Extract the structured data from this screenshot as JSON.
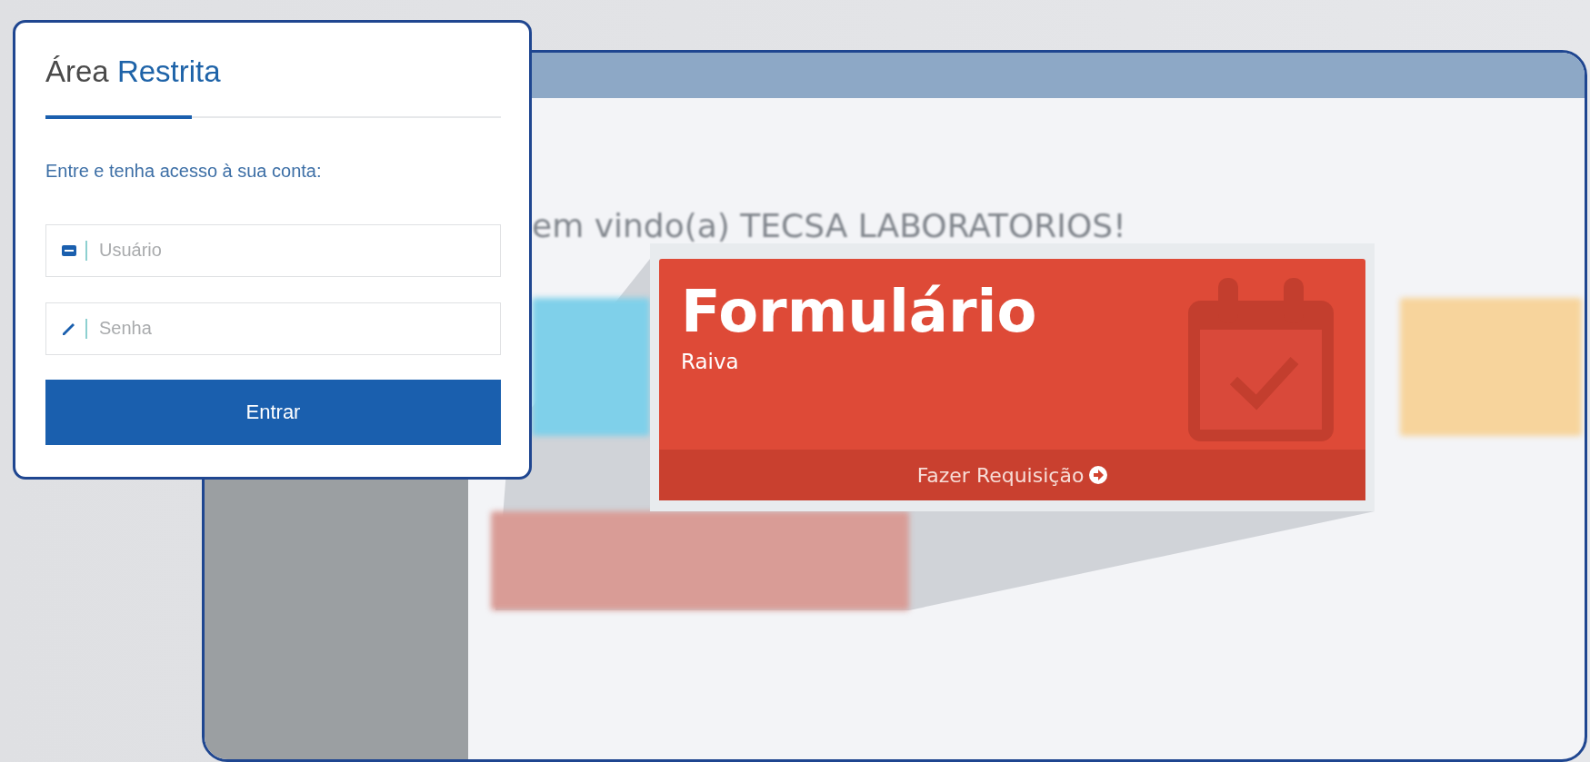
{
  "login": {
    "title_parts": [
      {
        "text": "Área",
        "accent": false
      },
      {
        "text": "Restrita",
        "accent": true
      }
    ],
    "subtitle": "Entre e tenha acesso à sua conta:",
    "fields": [
      {
        "kind": "user",
        "placeholder": "Usuário"
      },
      {
        "kind": "password",
        "placeholder": "Senha"
      }
    ],
    "button": "Entrar"
  },
  "page": {
    "heading": "em vindo(a) TECSA LABORATORIOS!",
    "cards": [
      {
        "color": "#7fd0ea"
      },
      {
        "color": "#f7d49c"
      },
      {
        "color": "#d99c96"
      }
    ]
  },
  "zoomed_card": {
    "title": "Formulário",
    "subtitle": "Raiva",
    "action": "Fazer Requisição"
  }
}
